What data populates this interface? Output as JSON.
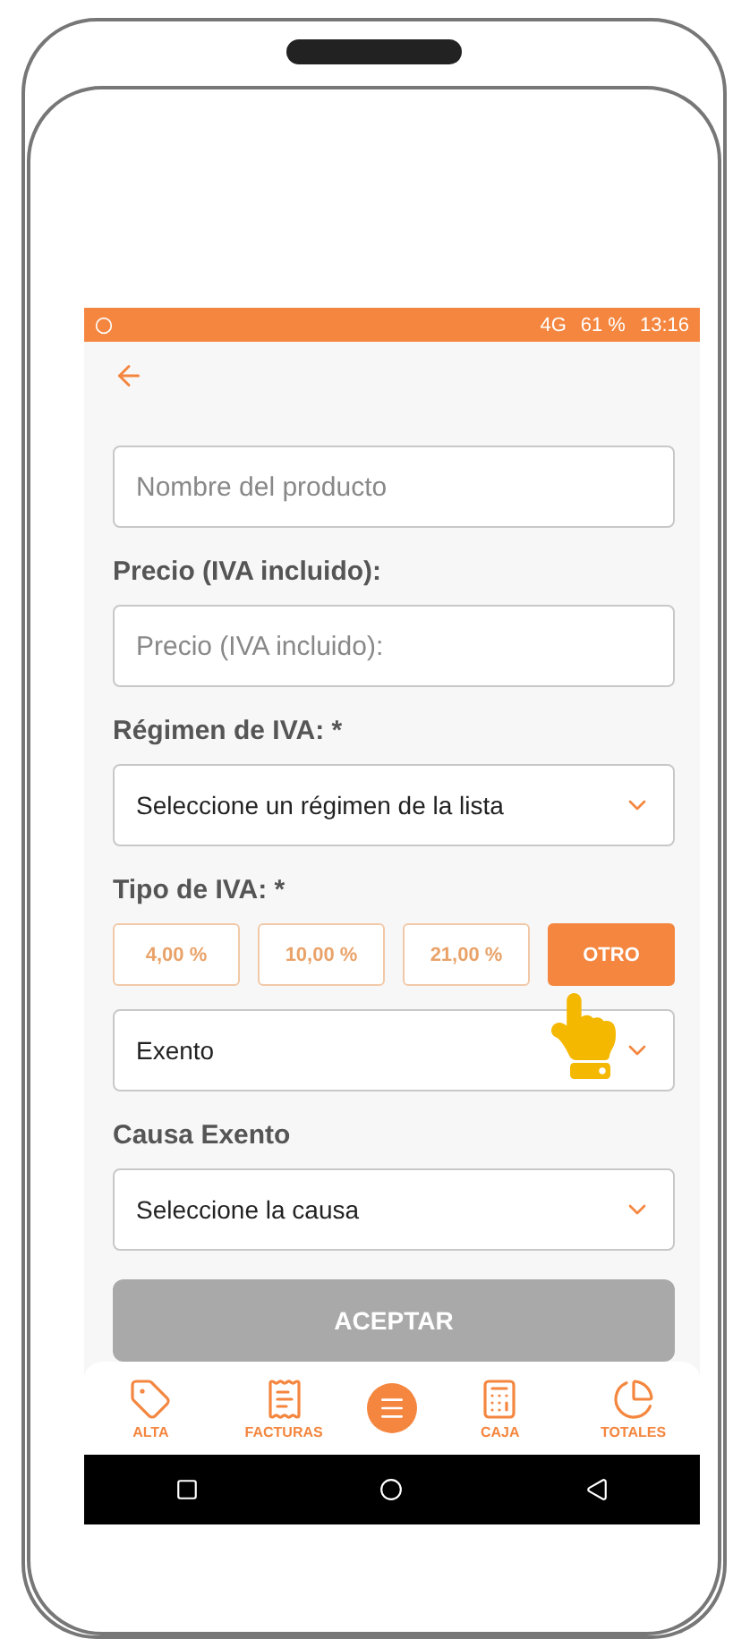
{
  "status_bar": {
    "network": "4G",
    "battery": "61 %",
    "time": "13:16"
  },
  "form": {
    "name_field": {
      "placeholder": "Nombre del producto"
    },
    "price": {
      "label": "Precio (IVA incluido):",
      "placeholder": "Precio (IVA incluido):"
    },
    "regimen": {
      "label": "Régimen de IVA: *",
      "value": "Seleccione un régimen de la lista"
    },
    "tipo": {
      "label": "Tipo de IVA: *",
      "options": [
        {
          "label": "4,00 %",
          "selected": false
        },
        {
          "label": "10,00 %",
          "selected": false
        },
        {
          "label": "21,00 %",
          "selected": false
        },
        {
          "label": "OTRO",
          "selected": true
        }
      ],
      "value": "Exento"
    },
    "causa": {
      "label": "Causa Exento",
      "value": "Seleccione la causa"
    },
    "submit": {
      "label": "ACEPTAR",
      "disabled": true
    }
  },
  "bottom_nav": [
    {
      "kind": "tag",
      "label": "ALTA"
    },
    {
      "kind": "invoice",
      "label": "FACTURAS"
    },
    {
      "kind": "menu"
    },
    {
      "kind": "register",
      "label": "CAJA"
    },
    {
      "kind": "pie",
      "label": "TOTALES"
    }
  ]
}
